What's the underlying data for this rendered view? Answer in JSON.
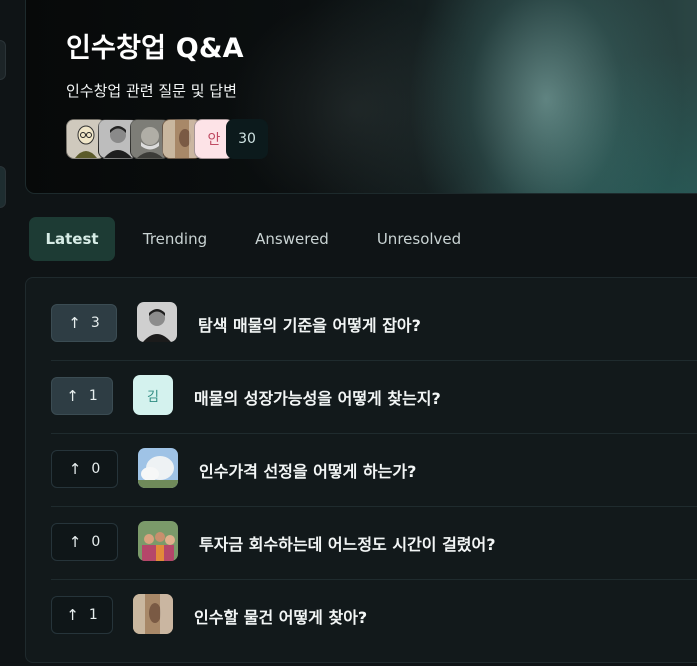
{
  "hero": {
    "title": "인수창업 Q&A",
    "subtitle": "인수창업 관련 질문 및 답변",
    "members": {
      "initial_avatar": "안",
      "count": "30"
    }
  },
  "tabs": [
    {
      "label": "Latest",
      "active": true
    },
    {
      "label": "Trending",
      "active": false
    },
    {
      "label": "Answered",
      "active": false
    },
    {
      "label": "Unresolved",
      "active": false
    }
  ],
  "questions": [
    {
      "votes": "3",
      "voted": true,
      "avatar": "photo",
      "title": "탐색 매물의 기준을 어떻게 잡아?"
    },
    {
      "votes": "1",
      "voted": true,
      "avatar": "김",
      "title": "매물의 성장가능성을 어떻게 찾는지?"
    },
    {
      "votes": "0",
      "voted": false,
      "avatar": "photo",
      "title": "인수가격 선정을 어떻게 하는가?"
    },
    {
      "votes": "0",
      "voted": false,
      "avatar": "photo",
      "title": "투자금 회수하는데 어느정도 시간이 걸렸어?"
    },
    {
      "votes": "1",
      "voted": false,
      "avatar": "photo",
      "title": "인수할 물건 어떻게 찾아?"
    }
  ],
  "icons": {
    "upvote": "arrow-up-icon"
  },
  "colors": {
    "background": "#0f1416",
    "accent_tab": "#1d3b34",
    "voted_bg": "#2e3d44",
    "letter_avatar_bg": "#d4f2ee"
  }
}
